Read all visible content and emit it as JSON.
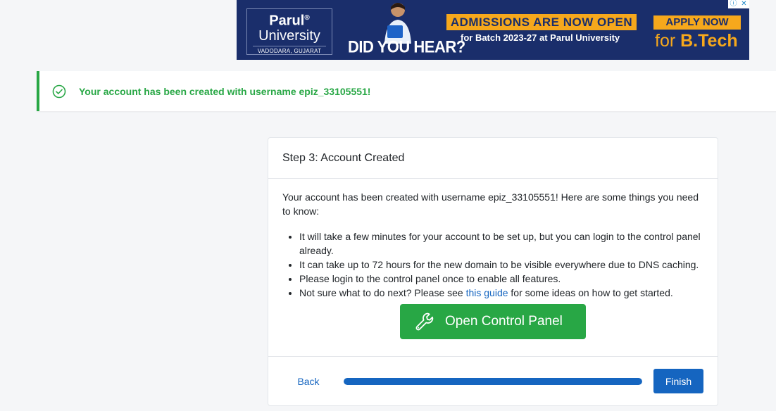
{
  "ad": {
    "brand": "Parul",
    "brand_mark": "®",
    "university": "University",
    "location": "VADODARA, GUJARAT",
    "headline": "DID YOU HEAR?",
    "admissions": "ADMISSIONS ARE NOW OPEN",
    "batch": "for Batch 2023-27 at Parul University",
    "apply": "APPLY NOW",
    "program_prefix": "for ",
    "program": "B.Tech",
    "info_icon": "ⓘ",
    "close_icon": "✕"
  },
  "alert": {
    "message": "Your account has been created with username epiz_33105551!",
    "icon": "check-circle-icon",
    "color": "#28a745"
  },
  "card": {
    "title": "Step 3: Account Created",
    "intro": "Your account has been created with username epiz_33105551! Here are some things you need to know:",
    "tips": [
      "It will take a few minutes for your account to be set up, but you can login to the control panel already.",
      "It can take up to 72 hours for the new domain to be visible everywhere due to DNS caching.",
      "Please login to the control panel once to enable all features."
    ],
    "tip_guide": {
      "before": "Not sure what to do next? Please see ",
      "link": "this guide",
      "after": " for some ideas on how to get started."
    },
    "cta_label": "Open Control Panel",
    "cta_icon": "wrench-icon"
  },
  "footer": {
    "back_label": "Back",
    "finish_label": "Finish",
    "progress_percent": 100,
    "accent": "#1565c0"
  }
}
